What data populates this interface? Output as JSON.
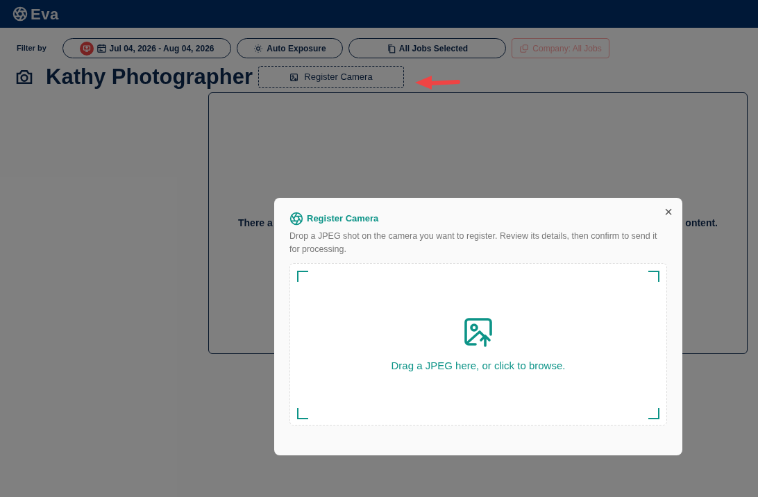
{
  "header": {
    "logo": "Eva"
  },
  "filters": {
    "label": "Filter by",
    "date_range": "Jul 04, 2026 - Aug 04, 2026",
    "exposure": "Auto Exposure",
    "jobs": "All Jobs Selected",
    "company": "Company: All Jobs"
  },
  "page": {
    "title": "Kathy Photographer",
    "register_button": "Register Camera"
  },
  "empty_state": {
    "text_left": "There a",
    "text_right": "ontent."
  },
  "modal": {
    "title": "Register Camera",
    "description": "Drop a JPEG shot on the camera you want to register. Review its details, then confirm to send it for processing.",
    "dropzone_text": "Drag a JPEG here, or click to browse.",
    "close": "×"
  }
}
